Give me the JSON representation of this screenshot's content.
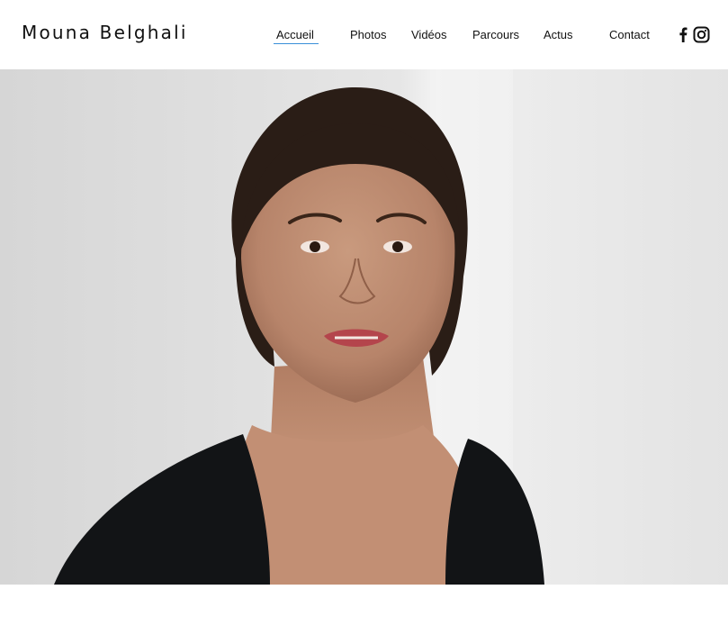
{
  "site": {
    "title": "Mouna Belghali"
  },
  "nav": {
    "items": [
      {
        "label": "Accueil",
        "active": true
      },
      {
        "label": "Photos",
        "active": false
      },
      {
        "label": "Vidéos",
        "active": false
      },
      {
        "label": "Parcours",
        "active": false
      },
      {
        "label": "Actus",
        "active": false
      },
      {
        "label": "Contact",
        "active": false
      }
    ],
    "accent_color": "#3a8fd8"
  },
  "social": {
    "icons": [
      "facebook-icon",
      "instagram-icon"
    ]
  },
  "hero": {
    "icon": "portrait-photo"
  }
}
